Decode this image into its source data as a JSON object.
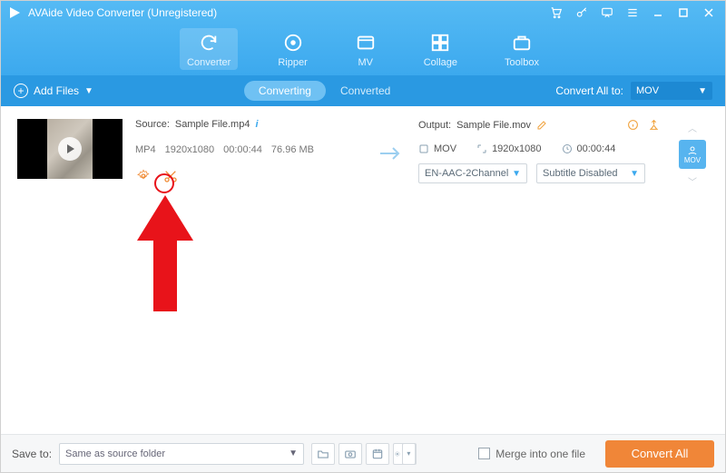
{
  "window": {
    "title": "AVAide Video Converter (Unregistered)"
  },
  "mainTabs": {
    "converter": "Converter",
    "ripper": "Ripper",
    "mv": "MV",
    "collage": "Collage",
    "toolbox": "Toolbox"
  },
  "subbar": {
    "addFiles": "Add Files",
    "converting": "Converting",
    "converted": "Converted",
    "convertAllTo": "Convert All to:",
    "convertAllFormat": "MOV"
  },
  "item": {
    "sourceLabel": "Source:",
    "sourceName": "Sample File.mp4",
    "srcFormat": "MP4",
    "srcResolution": "1920x1080",
    "srcDuration": "00:00:44",
    "srcSize": "76.96 MB",
    "outputLabel": "Output:",
    "outputName": "Sample File.mov",
    "outFormat": "MOV",
    "outResolution": "1920x1080",
    "outDuration": "00:00:44",
    "audioSelect": "EN-AAC-2Channel",
    "subtitleSelect": "Subtitle Disabled",
    "profileBadge": "MOV"
  },
  "bottom": {
    "saveToLabel": "Save to:",
    "saveToValue": "Same as source folder",
    "mergeLabel": "Merge into one file",
    "convertAll": "Convert All"
  }
}
